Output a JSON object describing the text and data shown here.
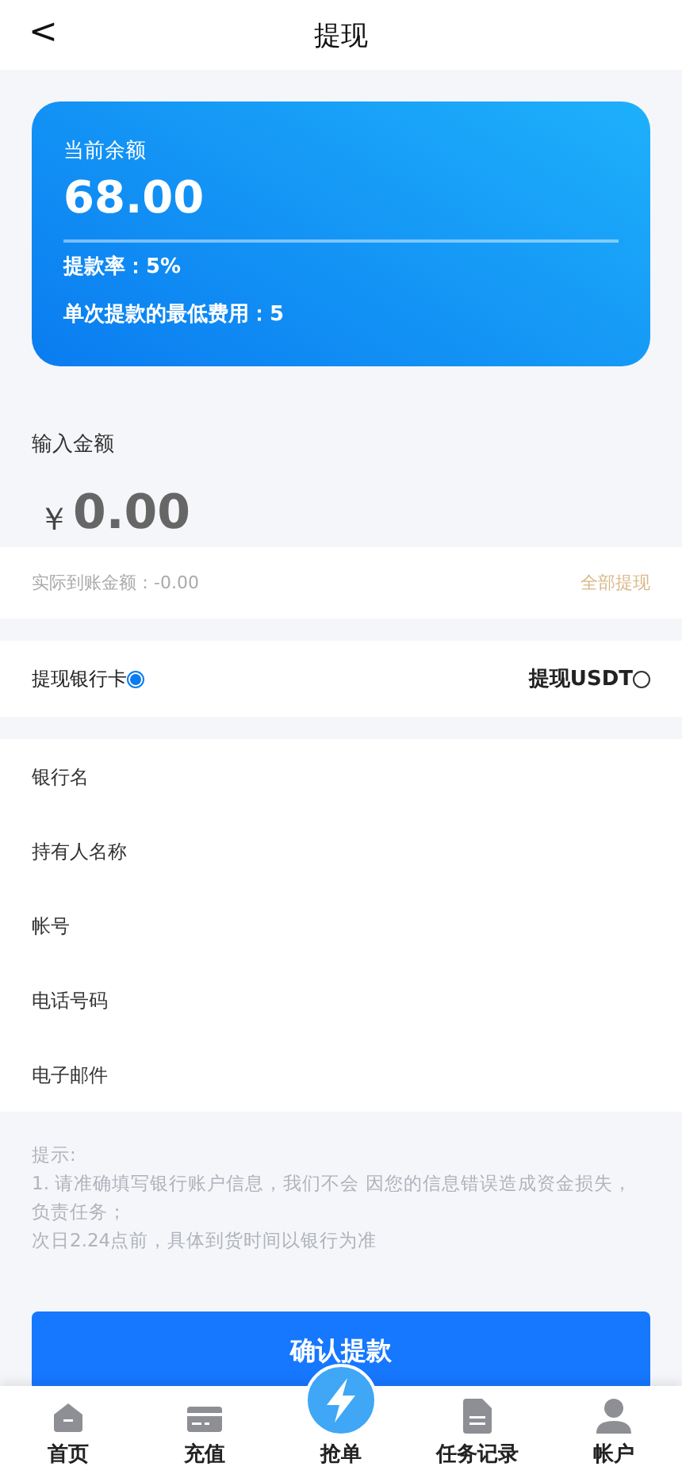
{
  "header": {
    "back": "<",
    "title": "提现"
  },
  "balance_card": {
    "label": "当前余额",
    "amount": "68.00",
    "rate": "提款率：5%",
    "min_fee": "单次提款的最低费用：5"
  },
  "amount_input": {
    "label": "输入金额",
    "currency": "￥",
    "placeholder": "0.00"
  },
  "actual_row": {
    "text": "实际到账金额：-0.00",
    "link": "全部提现"
  },
  "methods": [
    {
      "label": "提现银行卡",
      "selected": true,
      "kind": "left"
    },
    {
      "label": "提现USDT",
      "selected": false,
      "kind": "right"
    }
  ],
  "fields": [
    {
      "placeholder": "银行名"
    },
    {
      "placeholder": "持有人名称"
    },
    {
      "placeholder": "帐号"
    },
    {
      "placeholder": "电话号码"
    },
    {
      "placeholder": "电子邮件"
    }
  ],
  "tips": [
    "提示:",
    "1. 请准确填写银行账户信息，我们不会 因您的信息错误造成资金损失，负责任务；",
    "次日2.24点前，具体到货时间以银行为准"
  ],
  "submit": "确认提款",
  "tabbar": [
    {
      "label": "首页",
      "kind": "home"
    },
    {
      "label": "充值",
      "kind": "card"
    },
    {
      "label": "抢单",
      "kind": "center"
    },
    {
      "label": "任务记录",
      "kind": "doc"
    },
    {
      "label": "帐户",
      "kind": "user"
    }
  ]
}
